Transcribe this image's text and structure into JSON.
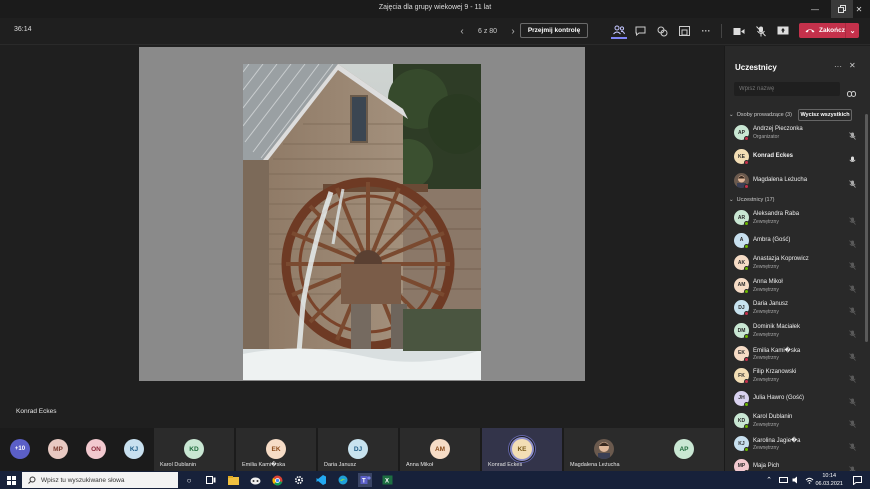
{
  "window": {
    "title": "Zajęcia dla grupy wiekowej 9 - 11 lat"
  },
  "toolbar": {
    "timer": "36:14",
    "page_indicator": "6 z 80",
    "take_control_label": "Przejmij kontrolę",
    "end_label": "Zakończ",
    "colors": {
      "end": "#c4314b",
      "accent": "#7f85f5"
    }
  },
  "stage": {
    "presenter_name": "Konrad Eckes"
  },
  "strip": {
    "overflow_count": "+10",
    "small_avatars": [
      {
        "initials": "MP",
        "color": "#e8c9c2"
      },
      {
        "initials": "ON",
        "color": "#f2c9cf"
      },
      {
        "initials": "KJ",
        "color": "#c8e0ef"
      }
    ],
    "tiles": [
      {
        "initials": "KD",
        "name": "Karol Dublanin",
        "color": "#c9e7d3"
      },
      {
        "initials": "EK",
        "name": "Emilia Kami�ska",
        "color": "#f6dcc6"
      },
      {
        "initials": "DJ",
        "name": "Daria Janusz",
        "color": "#c8e3ef"
      },
      {
        "initials": "AM",
        "name": "Anna Mikoł",
        "color": "#f6dcc6"
      },
      {
        "initials": "KE",
        "name": "Konrad Eckes",
        "color": "#f3deb5"
      },
      {
        "initials": "",
        "name": "Magdalena Leżucha",
        "color": "#6b5a4e"
      },
      {
        "initials": "AP",
        "name": "",
        "color": "#c9e7d3"
      }
    ]
  },
  "panel": {
    "title": "Uczestnicy",
    "search_placeholder": "Wpisz nazwę",
    "presenters_header": "Osoby prowadzące (3)",
    "mute_all_label": "Wycisz wszystkich",
    "attendees_header": "Uczestnicy (17)",
    "presenters": [
      {
        "initials": "AP",
        "name": "Andrzej Pieczonka",
        "role": "Organizator",
        "color": "#c9e7d3",
        "status": "#c4314b"
      },
      {
        "initials": "KE",
        "name": "Konrad Eckes",
        "role": "",
        "color": "#f3deb5",
        "status": "#c4314b"
      },
      {
        "initials": "",
        "name": "Magdalena Leżucha",
        "role": "",
        "color": "#6b5a4e",
        "status": "#c4314b"
      }
    ],
    "attendees": [
      {
        "initials": "AR",
        "name": "Aleksandra Raba",
        "role": "Zewnętrzny",
        "color": "#c9e7d3",
        "status": "#6bb700"
      },
      {
        "initials": "A",
        "name": "Ambra (Gość)",
        "role": "",
        "color": "#c8e0ef",
        "status": "#6bb700"
      },
      {
        "initials": "AK",
        "name": "Anastazja Koprowicz",
        "role": "Zewnętrzny",
        "color": "#f6dcc6",
        "status": "#6bb700"
      },
      {
        "initials": "AM",
        "name": "Anna Mikoł",
        "role": "Zewnętrzny",
        "color": "#f6dcc6",
        "status": "#6bb700"
      },
      {
        "initials": "DJ",
        "name": "Daria Janusz",
        "role": "Zewnętrzny",
        "color": "#c8e3ef",
        "status": "#c4314b"
      },
      {
        "initials": "DM",
        "name": "Dominik Maciałek",
        "role": "Zewnętrzny",
        "color": "#c9e7d3",
        "status": "#6bb700"
      },
      {
        "initials": "EK",
        "name": "Emilia Kami�ska",
        "role": "Zewnętrzny",
        "color": "#f6dcc6",
        "status": "#c4314b"
      },
      {
        "initials": "FK",
        "name": "Filip Krzanowski",
        "role": "Zewnętrzny",
        "color": "#f3deb5",
        "status": "#c4314b"
      },
      {
        "initials": "JH",
        "name": "Julia Hawro (Gość)",
        "role": "",
        "color": "#d9d2ef",
        "status": "#6bb700"
      },
      {
        "initials": "KD",
        "name": "Karol Dublanin",
        "role": "Zewnętrzny",
        "color": "#c9e7d3",
        "status": "#6bb700"
      },
      {
        "initials": "KJ",
        "name": "Karolina Jagie�a",
        "role": "Zewnętrzny",
        "color": "#c8e0ef",
        "status": "#6bb700"
      },
      {
        "initials": "MP",
        "name": "Maja Pich",
        "role": "",
        "color": "#f2c9cf",
        "status": "#6bb700"
      }
    ]
  },
  "taskbar": {
    "search_placeholder": "Wpisz tu wyszukiwane słowa",
    "time": "10:14",
    "date": "06.03.2021"
  }
}
